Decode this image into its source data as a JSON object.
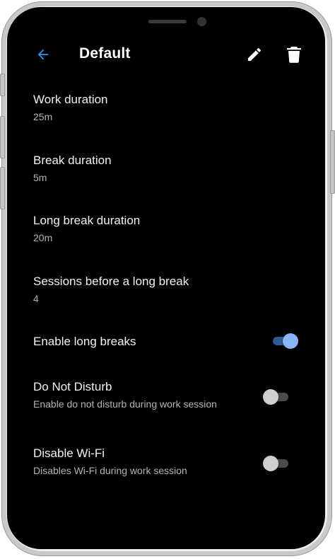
{
  "appbar": {
    "title": "Default",
    "back_icon": "arrow-back-icon",
    "edit_icon": "pencil-icon",
    "delete_icon": "trash-icon"
  },
  "settings": [
    {
      "title": "Work duration",
      "value": "25m"
    },
    {
      "title": "Break duration",
      "value": "5m"
    },
    {
      "title": "Long break duration",
      "value": "20m"
    },
    {
      "title": "Sessions before a long break",
      "value": "4"
    }
  ],
  "toggles": [
    {
      "title": "Enable long breaks",
      "subtitle": "",
      "checked": true
    },
    {
      "title": "Do Not Disturb",
      "subtitle": "Enable do not disturb during work session",
      "checked": false
    },
    {
      "title": "Disable Wi-Fi",
      "subtitle": "Disables Wi-Fi during work session",
      "checked": false
    }
  ],
  "colors": {
    "accent": "#2196f3",
    "switch_on_thumb": "#8ab4f8",
    "background": "#000000",
    "text_primary": "#f2f2f2",
    "text_secondary": "#b3b3b3"
  }
}
